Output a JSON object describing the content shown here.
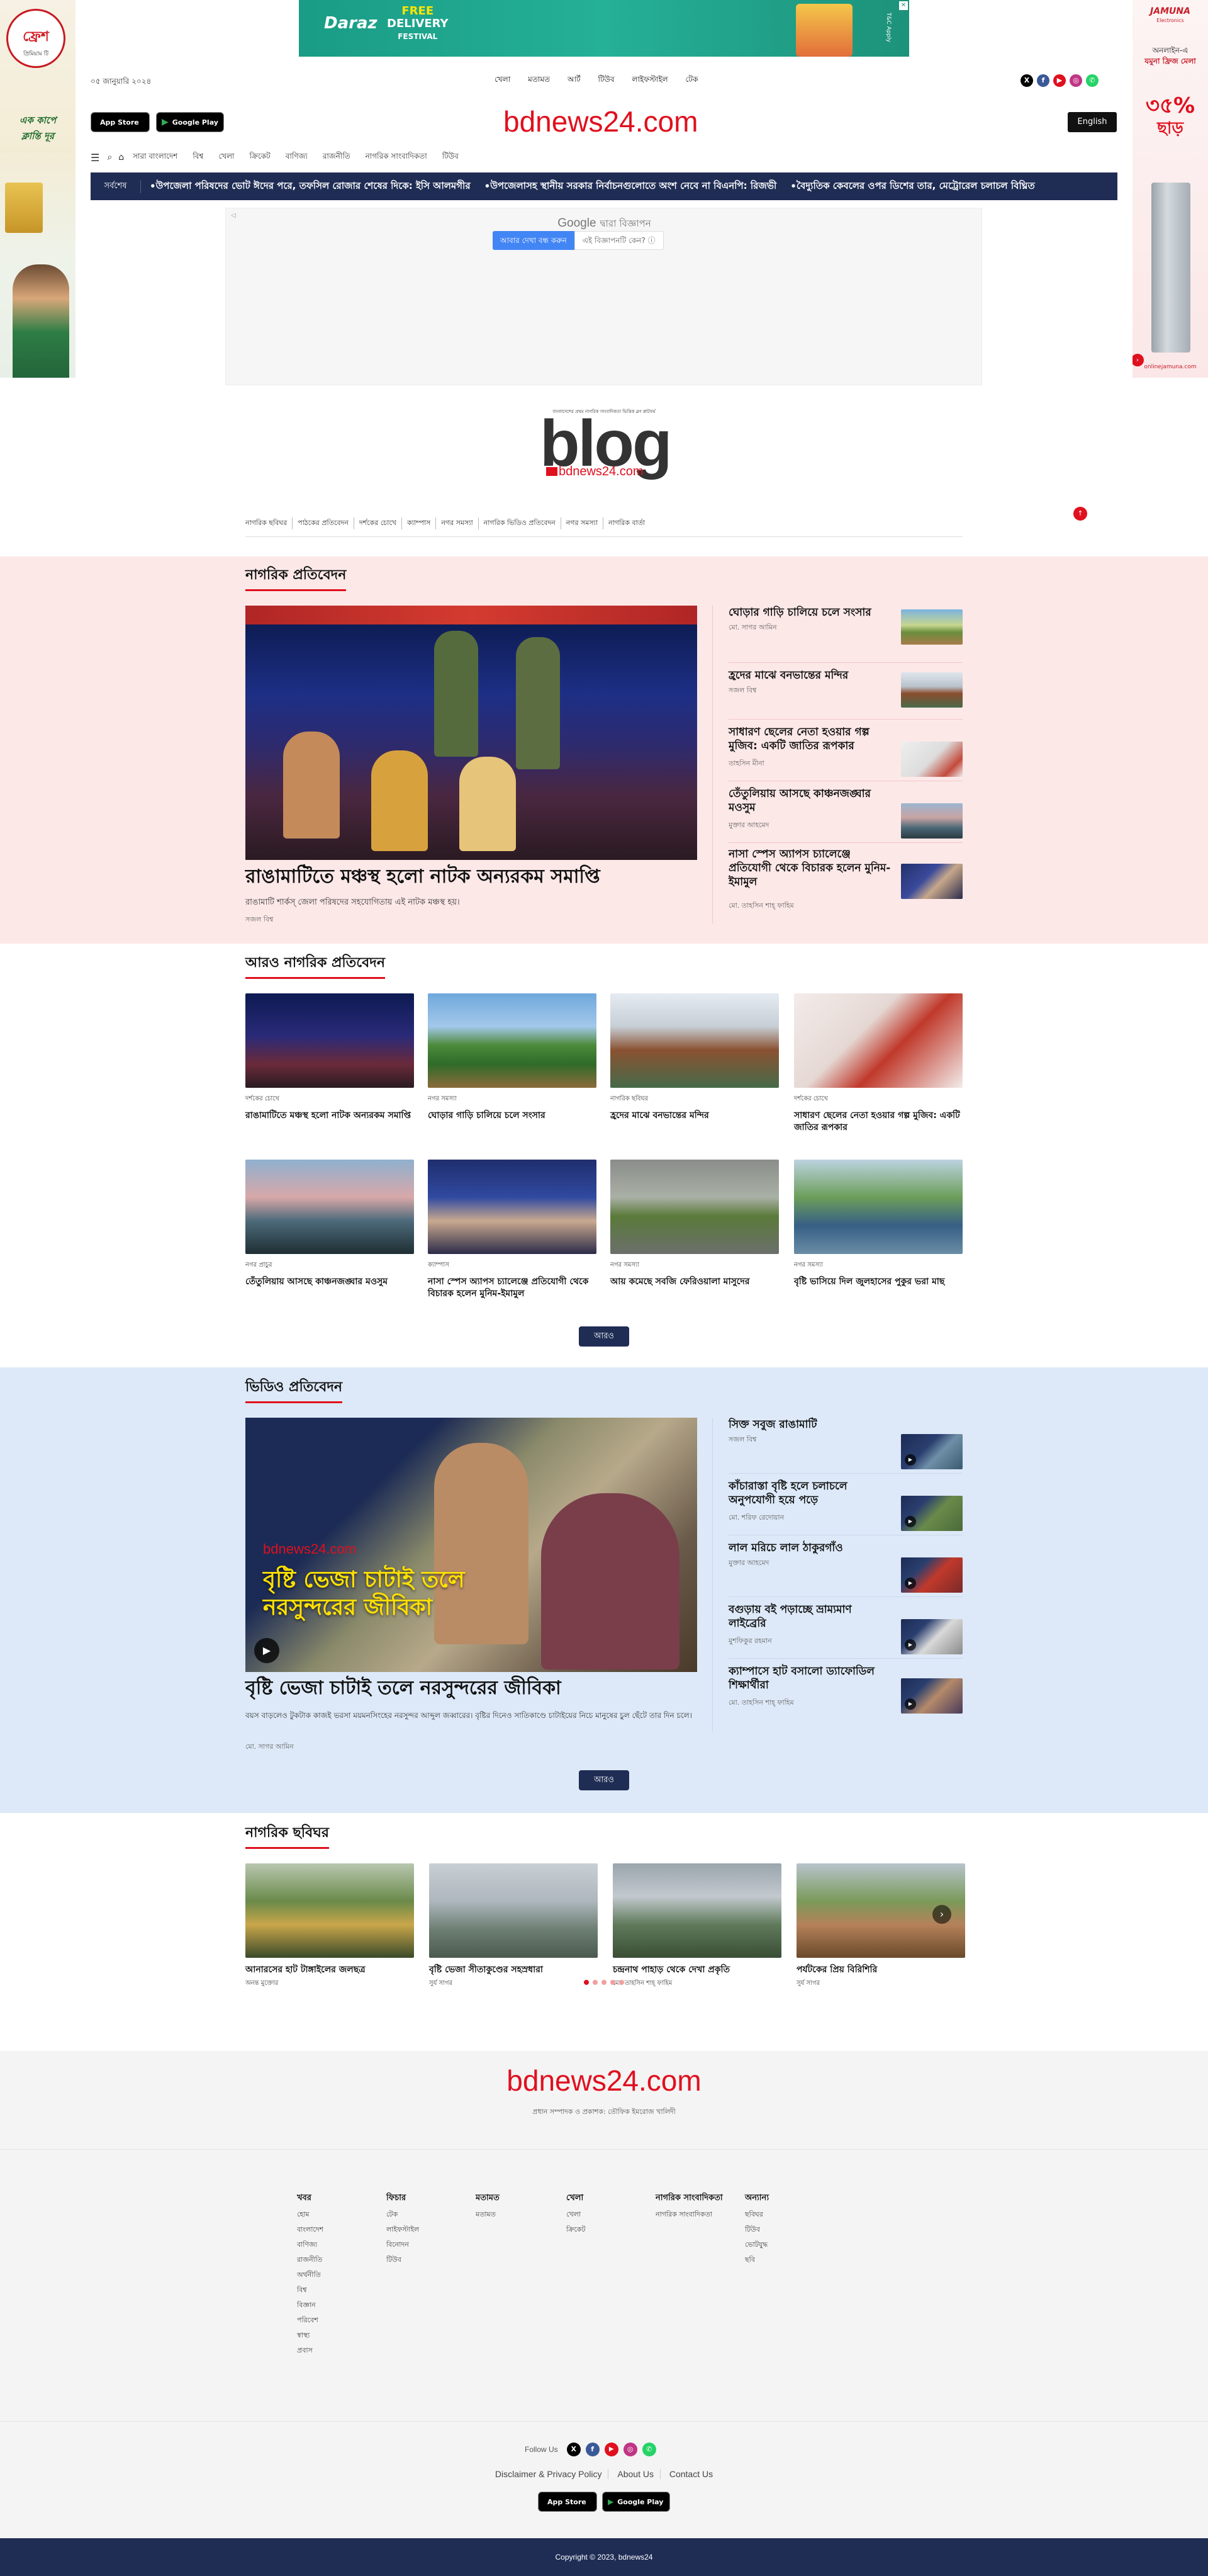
{
  "top_ad": {
    "brand": "Daraz",
    "title": "FREE",
    "subtitle": "DELIVERY",
    "sub2": "FESTIVAL",
    "side_note": "T&C Apply"
  },
  "left_skin": {
    "brand": "ফ্রেশ",
    "brand_sub": "প্রিমিয়াম টি",
    "line1": "এক কাপে",
    "line2": "ক্লান্তি দূর"
  },
  "right_skin": {
    "brand": "JAMUNA",
    "brand_sub": "Electronics",
    "line1": "অনলাইন-এ",
    "line2": "যমুনা ফ্রিজ মেলা",
    "discount": "৩৫%",
    "discount_sub": "ছাড়",
    "footer": "onlinejamuna.com"
  },
  "header": {
    "date": "০৫ জানুয়ারি ২০২৪",
    "topnav": [
      "খেলা",
      "মতামত",
      "আর্ট",
      "টিউব",
      "লাইফস্টাইল",
      "টেক"
    ],
    "logo": "bdnews24.com",
    "english": "English",
    "appstore": "App Store",
    "appstore_pre": "Download on the",
    "playstore": "Google Play",
    "playstore_pre": "GET IT ON",
    "mainnav": [
      "সারা বাংলাদেশ",
      "বিশ্ব",
      "খেলা",
      "ক্রিকেট",
      "বাণিজ্য",
      "রাজনীতি",
      "নাগরিক সাংবাদিকতা",
      "টিউব"
    ]
  },
  "ticker": {
    "label": "সর্বশেষ",
    "items": [
      "উপজেলা পরিষদের ভোট ঈদের পরে, তফসিল রোজার শেষের দিকে: ইসি আলমগীর",
      "উপজেলাসহ স্থানীয় সরকার নির্বাচনগুলোতে অংশ নেবে না বিএনপি: রিজভী",
      "বৈদ্যুতিক কেবলের ওপর ডিশের তার, মেট্রোরেল চলাচল বিঘ্নিত"
    ]
  },
  "google_ad": {
    "label": "Google",
    "label_tail": "দ্বারা বিজ্ঞাপন",
    "stop": "আবার দেখা বন্ধ করুন",
    "why": "এই বিজ্ঞাপনটি কেন? ⓘ"
  },
  "blog": {
    "tagline": "বাংলাদেশের প্রথম নাগরিক সাংবাদিকতা ভিত্তিক ব্লগ প্লাটফর্ম",
    "word": "blog",
    "sub": "bdnews24.com",
    "nav": [
      "নাগরিক ছবিঘর",
      "পাঠকের প্রতিবেদন",
      "দর্শকের চোখে",
      "ক্যাম্পাস",
      "নগর সমস্যা",
      "নাগরিক ভিডিও প্রতিবেদন",
      "নগর সমস্যা",
      "নাগরিক বার্তা"
    ]
  },
  "nagorik": {
    "title": "নাগরিক প্রতিবেদন",
    "lead": {
      "title": "রাঙামাটিতে মঞ্চস্থ হলো নাটক অন্যরকম সমাপ্তি",
      "summary": "রাঙামাটি শার্কস্ জেলা পরিষদের সহযোগিতায় এই নাটক মঞ্চস্থ হয়।",
      "author": "সজল বিশ্ব"
    },
    "side": [
      {
        "title": "ঘোড়ার গাড়ি চালিয়ে চলে সংসার",
        "author": "মো. সাগর আমিন"
      },
      {
        "title": "হ্রদের মাঝে বনভান্তের মন্দির",
        "author": "সজল বিশ্ব"
      },
      {
        "title": "সাধারণ ছেলের নেতা হওয়ার গল্প মুজিব: একটি জাতির রূপকার",
        "author": "তাহসিন মীনা"
      },
      {
        "title": "তেঁতুলিয়ায় আসছে কাঞ্চনজঙ্ঘার মওসুম",
        "author": "মুক্তার আহমেদ"
      },
      {
        "title": "নাসা স্পেস অ্যাপস চ্যালেঞ্জে প্রতিযোগী থেকে বিচারক হলেন মুনিম-ইমামুল",
        "author": "মো. তাহসিন শাহ্ ফাহিম"
      }
    ]
  },
  "more_nagorik": {
    "title": "আরও নাগরিক প্রতিবেদন",
    "more": "আরও",
    "cards": [
      {
        "cat": "দর্শকের চোখে",
        "title": "রাঙামাটিতে মঞ্চস্থ হলো নাটক অন্যরকম সমাপ্তি"
      },
      {
        "cat": "নগর সমস্যা",
        "title": "ঘোড়ার গাড়ি চালিয়ে চলে সংসার"
      },
      {
        "cat": "নাগরিক ছবিঘর",
        "title": "হ্রদের মাঝে বনভান্তের মন্দির"
      },
      {
        "cat": "দর্শকের চোখে",
        "title": "সাধারণ ছেলের নেতা হওয়ার গল্প মুজিব: একটি জাতির রূপকার"
      },
      {
        "cat": "নগর প্রাচুর",
        "title": "তেঁতুলিয়ায় আসছে কাঞ্চনজঙ্ঘার মওসুম"
      },
      {
        "cat": "ক্যাম্পাস",
        "title": "নাসা স্পেস অ্যাপস চ্যালেঞ্জে প্রতিযোগী থেকে বিচারক হলেন মুনিম-ইমামুল"
      },
      {
        "cat": "নগর সমস্যা",
        "title": "আয় কমেছে সবজি ফেরিওয়ালা মাসুদের"
      },
      {
        "cat": "নগর সমস্যা",
        "title": "বৃষ্টি ভাসিয়ে দিল জুলহাসের পুকুর ভরা মাছ"
      }
    ]
  },
  "video": {
    "title": "ভিডিও প্রতিবেদন",
    "more": "আরও",
    "lead": {
      "brand": "bdnews24.com",
      "overlay": "বৃষ্টি ভেজা চাটাই তলে নরসুন্দরের জীবিকা",
      "title": "বৃষ্টি ভেজা চাটাই তলে নরসুন্দরের জীবিকা",
      "summary": "বয়স বাড়লেও টুকটাক কাজই ভরসা ময়মনসিংহের নরসুন্দর আব্দুল জব্বারের। বৃষ্টির দিনেও সাতিকাণ্ডে চাটাইয়ের নিচে মানুষের চুল ছেঁটে তার দিন চলে।",
      "author": "মো. সাগর আমিন"
    },
    "side": [
      {
        "title": "সিক্ত সবুজ রাঙামাটি",
        "author": "সজল বিশ্ব"
      },
      {
        "title": "কাঁচারাস্তা বৃষ্টি হলে চলাচলে অনুপযোগী হয়ে পড়ে",
        "author": "মো. শরিফ রেদোয়ান"
      },
      {
        "title": "লাল মরিচে লাল ঠাকুরগাঁও",
        "author": "মুক্তার আহমেদ"
      },
      {
        "title": "বগুড়ায় বই পড়াচ্ছে ভ্রাম্যমাণ লাইব্রেরি",
        "author": "মুশফিকুর রহমান"
      },
      {
        "title": "ক্যাম্পাসে হাট বসালো ড্যাফোডিল শিক্ষার্থীরা",
        "author": "মো. তাহসিন শাহ্ ফাহিম"
      }
    ]
  },
  "chobighor": {
    "title": "নাগরিক ছবিঘর",
    "cards": [
      {
        "title": "আনারসের হাট টাঙ্গাইলের জলছত্র",
        "author": "অনন্ত মুক্তোর"
      },
      {
        "title": "বৃষ্টি ভেজা সীতাকুণ্ডের সহস্রধারা",
        "author": "সুর্য সাগর"
      },
      {
        "title": "চন্দ্রনাথ পাহাড় থেকে দেখা প্রকৃতি",
        "author": "মো. তাহসিন শাহ্ ফাহিম"
      },
      {
        "title": "পর্যটকের প্রিয় বিরিশিরি",
        "author": "সুর্য সাগর"
      }
    ]
  },
  "footer": {
    "logo": "bdnews24.com",
    "editor": "প্রধান সম্পাদক ও প্রকাশক: তৌফিক ইমরোজ খালিদী",
    "columns": [
      {
        "h": "খবর",
        "items": [
          "হোম",
          "বাংলাদেশ",
          "বাণিজ্য",
          "রাজনীতি",
          "অর্থনীতি",
          "বিশ্ব",
          "বিজ্ঞান",
          "পরিবেশ",
          "স্বাস্থ্য",
          "প্রবাস"
        ]
      },
      {
        "h": "ফিচার",
        "items": [
          "টেক",
          "লাইফস্টাইল",
          "বিনোদন",
          "টিউব"
        ]
      },
      {
        "h": "মতামত",
        "items": [
          "মতামত"
        ]
      },
      {
        "h": "খেলা",
        "items": [
          "খেলা",
          "ক্রিকেট"
        ]
      },
      {
        "h": "নাগরিক সাংবাদিকতা",
        "items": [
          "নাগরিক সাংবাদিকতা"
        ]
      },
      {
        "h": "অন্যান্য",
        "items": [
          "ছবিঘর",
          "টিউব",
          "ভোটযুদ্ধ",
          "ছবি"
        ]
      }
    ],
    "follow": "Follow Us",
    "links": [
      "Disclaimer & Privacy Policy",
      "About Us",
      "Contact Us"
    ],
    "copyright": "Copyright © 2023, bdnews24"
  },
  "colors": {
    "brand_red": "#e0101e",
    "navy": "#1f2d55",
    "pink_bg": "#fde8e8",
    "blue_bg": "#dde9f8"
  }
}
